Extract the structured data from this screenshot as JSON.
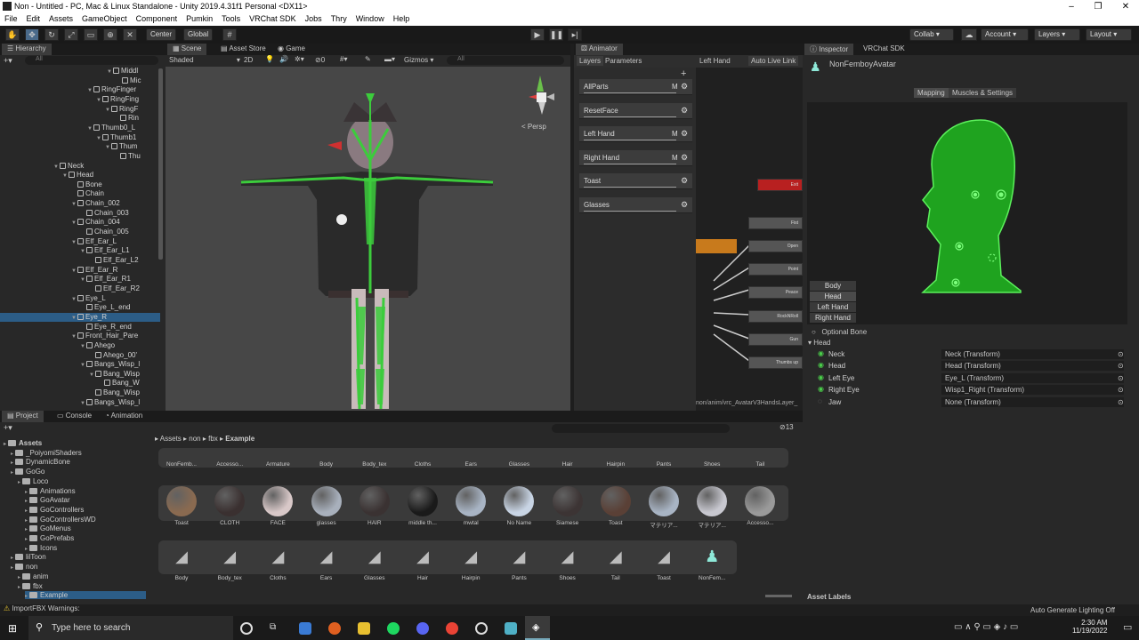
{
  "window": {
    "title": "Non - Untitled - PC, Mac & Linux Standalone - Unity 2019.4.31f1 Personal <DX11>",
    "min": "–",
    "max": "❐",
    "close": "✕"
  },
  "menu": [
    "File",
    "Edit",
    "Assets",
    "GameObject",
    "Component",
    "Pumkin",
    "Tools",
    "VRChat SDK",
    "Jobs",
    "Thry",
    "Window",
    "Help"
  ],
  "toolbar": {
    "center": "Center",
    "global": "Global",
    "collab": "Collab ▾",
    "account": "Account",
    "layers": "Layers",
    "layout": "Layout"
  },
  "hierarchy": {
    "tab": "Hierarchy",
    "search_placeholder": "All",
    "rows": [
      {
        "label": "Middl",
        "indent": 140,
        "arrow": true
      },
      {
        "label": "Mic",
        "indent": 150,
        "arrow": false
      },
      {
        "label": "RingFinger",
        "indent": 118,
        "arrow": true
      },
      {
        "label": "RingFing",
        "indent": 128,
        "arrow": true
      },
      {
        "label": "RingF",
        "indent": 138,
        "arrow": true
      },
      {
        "label": "Rin",
        "indent": 148,
        "arrow": false
      },
      {
        "label": "Thumb0_L",
        "indent": 118,
        "arrow": true
      },
      {
        "label": "Thumb1",
        "indent": 128,
        "arrow": true
      },
      {
        "label": "Thum",
        "indent": 138,
        "arrow": true
      },
      {
        "label": "Thu",
        "indent": 148,
        "arrow": false
      },
      {
        "label": "Neck",
        "indent": 80,
        "arrow": true
      },
      {
        "label": "Head",
        "indent": 90,
        "arrow": true
      },
      {
        "label": "Bone",
        "indent": 100,
        "arrow": false
      },
      {
        "label": "Chain",
        "indent": 100,
        "arrow": false
      },
      {
        "label": "Chain_002",
        "indent": 100,
        "arrow": true
      },
      {
        "label": "Chain_003",
        "indent": 110,
        "arrow": false
      },
      {
        "label": "Chain_004",
        "indent": 100,
        "arrow": true
      },
      {
        "label": "Chain_005",
        "indent": 110,
        "arrow": false
      },
      {
        "label": "Elf_Ear_L",
        "indent": 100,
        "arrow": true
      },
      {
        "label": "Elf_Ear_L1",
        "indent": 110,
        "arrow": true
      },
      {
        "label": "Elf_Ear_L2",
        "indent": 120,
        "arrow": false
      },
      {
        "label": "Elf_Ear_R",
        "indent": 100,
        "arrow": true
      },
      {
        "label": "Elf_Ear_R1",
        "indent": 110,
        "arrow": true
      },
      {
        "label": "Elf_Ear_R2",
        "indent": 120,
        "arrow": false
      },
      {
        "label": "Eye_L",
        "indent": 100,
        "arrow": true
      },
      {
        "label": "Eye_L_end",
        "indent": 110,
        "arrow": false
      },
      {
        "label": "Eye_R",
        "indent": 100,
        "arrow": true,
        "selected": true
      },
      {
        "label": "Eye_R_end",
        "indent": 110,
        "arrow": false
      },
      {
        "label": "Front_Hair_Pare",
        "indent": 100,
        "arrow": true
      },
      {
        "label": "Ahego",
        "indent": 110,
        "arrow": true
      },
      {
        "label": "Ahego_00'",
        "indent": 120,
        "arrow": false
      },
      {
        "label": "Bangs_Wisp_l",
        "indent": 110,
        "arrow": true
      },
      {
        "label": "Bang_Wisp",
        "indent": 120,
        "arrow": true
      },
      {
        "label": "Bang_W",
        "indent": 130,
        "arrow": false
      },
      {
        "label": "Bang_Wisp",
        "indent": 120,
        "arrow": false
      },
      {
        "label": "Bangs_Wisp_l",
        "indent": 110,
        "arrow": true
      }
    ]
  },
  "scene": {
    "tabs": [
      "Scene",
      "Asset Store",
      "Game"
    ],
    "shading": "Shaded",
    "mode2d": "2D",
    "gizmos": "Gizmos",
    "search": "All",
    "persp": "< Persp",
    "layers_count": "0"
  },
  "animator": {
    "tab": "Animator",
    "layers_tab": "Layers",
    "params_tab": "Parameters",
    "breadcrumb": "Left Hand",
    "auto_live": "Auto Live Link",
    "layers": [
      {
        "name": "AllParts",
        "m": "M"
      },
      {
        "name": "ResetFace",
        "m": ""
      },
      {
        "name": "Left Hand",
        "m": "M"
      },
      {
        "name": "Right Hand",
        "m": "M"
      },
      {
        "name": "Toast",
        "m": ""
      },
      {
        "name": "Glasses",
        "m": ""
      }
    ],
    "states": [
      "Exit",
      "Fist",
      "Open",
      "Point",
      "Peace",
      "RockNRoll",
      "Gun",
      "Thumbs up"
    ],
    "path": "non/anim/vrc_AvatarV3HandsLayer_"
  },
  "inspector": {
    "tab": "Inspector",
    "tab2": "VRChat SDK",
    "object": "NonFemboyAvatar",
    "mapping": "Mapping",
    "muscles": "Muscles & Settings",
    "body_buttons": [
      "Body",
      "Head",
      "Left Hand",
      "Right Hand"
    ],
    "optional": "Optional Bone",
    "section": "Head",
    "bones": [
      {
        "name": "Neck",
        "value": "Neck (Transform)"
      },
      {
        "name": "Head",
        "value": "Head (Transform)"
      },
      {
        "name": "Left Eye",
        "value": "Eye_L (Transform)"
      },
      {
        "name": "Right Eye",
        "value": "Wisp1_Right (Transform)"
      },
      {
        "name": "Jaw",
        "value": "None (Transform)"
      }
    ],
    "asset_labels": "Asset Labels",
    "auto_lighting": "Auto Generate Lighting Off"
  },
  "project": {
    "tabs": [
      "Project",
      "Console",
      "Animation"
    ],
    "tree": [
      {
        "label": "Assets",
        "indent": 0,
        "bold": true
      },
      {
        "label": "_PoiyomiShaders",
        "indent": 8
      },
      {
        "label": "DynamicBone",
        "indent": 8
      },
      {
        "label": "GoGo",
        "indent": 8
      },
      {
        "label": "Loco",
        "indent": 16
      },
      {
        "label": "Animations",
        "indent": 24
      },
      {
        "label": "GoAvatar",
        "indent": 24
      },
      {
        "label": "GoControllers",
        "indent": 24
      },
      {
        "label": "GoControllersWD",
        "indent": 24
      },
      {
        "label": "GoMenus",
        "indent": 24
      },
      {
        "label": "GoPrefabs",
        "indent": 24
      },
      {
        "label": "Icons",
        "indent": 24
      },
      {
        "label": "lilToon",
        "indent": 8
      },
      {
        "label": "non",
        "indent": 8
      },
      {
        "label": "anim",
        "indent": 16
      },
      {
        "label": "fbx",
        "indent": 16
      },
      {
        "label": "Example",
        "indent": 24,
        "selected": true
      }
    ],
    "breadcrumb": [
      "Assets",
      "non",
      "fbx",
      "Example"
    ],
    "count": "13",
    "row1": [
      "NonFemb...",
      "Accesso...",
      "Armature",
      "Body",
      "Body_tex",
      "Cloths",
      "Ears",
      "Glasses",
      "Hair",
      "Hairpin",
      "Pants",
      "Shoes",
      "Tail"
    ],
    "row2": [
      "Toast",
      "CLOTH",
      "FACE",
      "glasses",
      "HAIR",
      "middle th...",
      "mwtal",
      "No Name",
      "Siamese",
      "Toast",
      "マテリア...",
      "マテリア...",
      "Accesso..."
    ],
    "row3": [
      "Body",
      "Body_tex",
      "Cloths",
      "Ears",
      "Glasses",
      "Hair",
      "Hairpin",
      "Pants",
      "Shoes",
      "Tail",
      "Toast",
      "NonFem..."
    ],
    "row2_colors": [
      "#8a6a50",
      "#3a3030",
      "#d8c8c8",
      "#a8b0bc",
      "#3a3232",
      "#1a1a1a",
      "#a8b4c4",
      "#c8d4e4",
      "#3c3434",
      "#5a4036",
      "#a8b4c4",
      "#c8c8d0",
      "#9a9a9a"
    ]
  },
  "status": {
    "warning": "ImportFBX Warnings:"
  },
  "taskbar": {
    "search": "Type here to search",
    "time": "2:30 AM",
    "date": "11/19/2022"
  }
}
